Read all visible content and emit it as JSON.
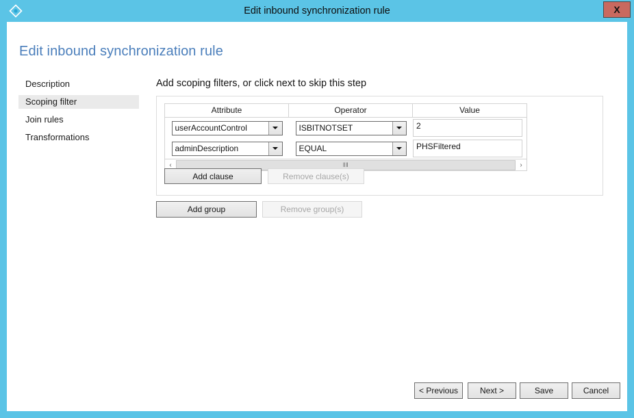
{
  "window": {
    "title": "Edit inbound synchronization rule",
    "close_label": "X",
    "app_icon": "azure-ad-connect-diamond-icon",
    "accent_color": "#5bc4e6",
    "close_color": "#c9695f"
  },
  "page": {
    "title": "Edit inbound synchronization rule",
    "title_color": "#4a7ebb"
  },
  "sidebar": {
    "items": [
      {
        "label": "Description",
        "selected": false
      },
      {
        "label": "Scoping filter",
        "selected": true
      },
      {
        "label": "Join rules",
        "selected": false
      },
      {
        "label": "Transformations",
        "selected": false
      }
    ]
  },
  "main": {
    "heading": "Add scoping filters, or click next to skip this step",
    "table": {
      "columns": [
        "Attribute",
        "Operator",
        "Value"
      ],
      "rows": [
        {
          "attribute": "userAccountControl",
          "operator": "ISBITNOTSET",
          "value": "2"
        },
        {
          "attribute": "adminDescription",
          "operator": "EQUAL",
          "value": "PHSFiltered"
        }
      ]
    },
    "scrollbar": {
      "left_arrow": "‹",
      "right_arrow": "›",
      "grip": "‖‖"
    },
    "clause_buttons": {
      "add": "Add clause",
      "remove": "Remove clause(s)",
      "remove_disabled": true
    },
    "group_buttons": {
      "add": "Add group",
      "remove": "Remove group(s)",
      "remove_disabled": true
    }
  },
  "footer": {
    "previous": "< Previous",
    "next": "Next >",
    "save": "Save",
    "cancel": "Cancel"
  }
}
